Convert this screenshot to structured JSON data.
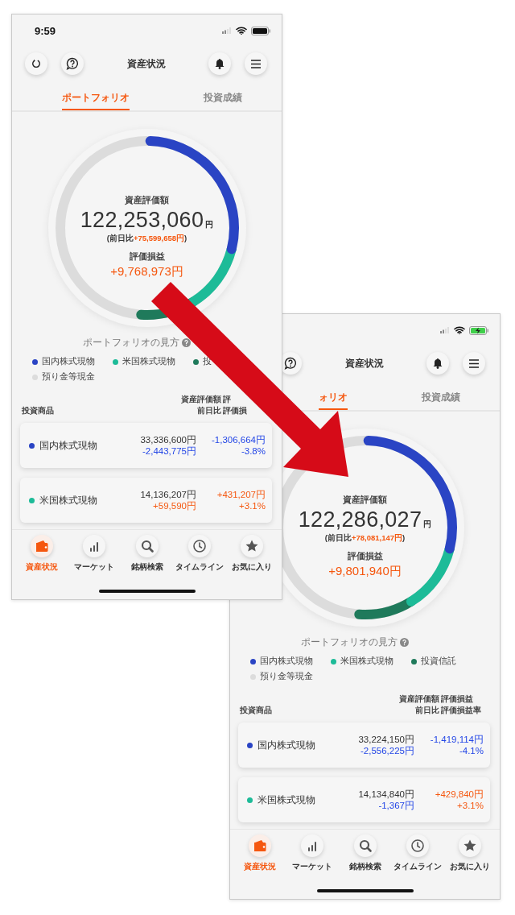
{
  "phones": [
    {
      "status_bar": {
        "time": "9:59",
        "battery_charging": false
      },
      "title": "資産状況",
      "tabs": [
        {
          "label": "ポートフォリオ",
          "selected": true
        },
        {
          "label": "投資成績",
          "selected": false
        }
      ],
      "summary": {
        "label": "資産評価額",
        "amount": "122,253,060",
        "unit": "円",
        "day_change": {
          "open": "(前日比",
          "value": "+75,599,658円",
          "close": ")",
          "gain": true
        },
        "pl_label": "評価損益",
        "pl": "+9,768,973円",
        "pl_gain": true
      },
      "legend_title": "ポートフォリオの見方",
      "legend": [
        {
          "label": "国内株式現物",
          "color": "#2a44c4"
        },
        {
          "label": "米国株式現物",
          "color": "#1dbb98"
        },
        {
          "label": "投",
          "color": "#1f7a5b"
        },
        {
          "label": "預り金等現金",
          "color": "#dcdcdc"
        }
      ],
      "table": {
        "columns": [
          [
            "投資商品"
          ],
          [
            "資産評価額",
            "前日比"
          ],
          [
            "評",
            "評価損"
          ]
        ],
        "rows": [
          {
            "name": "国内株式現物",
            "color": "#2a44c4",
            "value": "33,336,600円",
            "change": "-2,443,775円",
            "change_gain": false,
            "pl": "-1,306,664円",
            "pl_rate": "-3.8%",
            "pl_gain": false
          },
          {
            "name": "米国株式現物",
            "color": "#1dbb98",
            "value": "14,136,207円",
            "change": "+59,590円",
            "change_gain": true,
            "pl": "+431,207円",
            "pl_rate": "+3.1%",
            "pl_gain": true
          }
        ]
      },
      "nav": [
        {
          "label": "資産状況",
          "selected": true
        },
        {
          "label": "マーケット",
          "selected": false
        },
        {
          "label": "銘柄検索",
          "selected": false
        },
        {
          "label": "タイムライン",
          "selected": false
        },
        {
          "label": "お気に入り",
          "selected": false
        }
      ]
    },
    {
      "status_bar": {
        "battery_charging": true
      },
      "title": "資産状況",
      "tabs": [
        {
          "label": "ォリオ",
          "selected": true
        },
        {
          "label": "投資成績",
          "selected": false
        }
      ],
      "summary": {
        "label": "資産評価額",
        "amount": "122,286,027",
        "unit": "円",
        "day_change": {
          "open": "(前日比",
          "value": "+78,081,147円",
          "close": ")",
          "gain": true
        },
        "pl_label": "評価損益",
        "pl": "+9,801,940円",
        "pl_gain": true
      },
      "legend_title": "ポートフォリオの見方",
      "legend": [
        {
          "label": "国内株式現物",
          "color": "#2a44c4"
        },
        {
          "label": "米国株式現物",
          "color": "#1dbb98"
        },
        {
          "label": "投資信託",
          "color": "#1f7a5b"
        },
        {
          "label": "預り金等現金",
          "color": "#dcdcdc"
        }
      ],
      "table": {
        "columns": [
          [
            "投資商品"
          ],
          [
            "資産評価額",
            "前日比"
          ],
          [
            "評価損益",
            "評価損益率"
          ]
        ],
        "rows": [
          {
            "name": "国内株式現物",
            "color": "#2a44c4",
            "value": "33,224,150円",
            "change": "-2,556,225円",
            "change_gain": false,
            "pl": "-1,419,114円",
            "pl_rate": "-4.1%",
            "pl_gain": false
          },
          {
            "name": "米国株式現物",
            "color": "#1dbb98",
            "value": "14,134,840円",
            "change": "-1,367円",
            "change_gain": false,
            "pl": "+429,840円",
            "pl_rate": "+3.1%",
            "pl_gain": true
          }
        ]
      },
      "nav": [
        {
          "label": "資産状況",
          "selected": true
        },
        {
          "label": "マーケット",
          "selected": false
        },
        {
          "label": "銘柄検索",
          "selected": false
        },
        {
          "label": "タイムライン",
          "selected": false
        },
        {
          "label": "お気に入り",
          "selected": false
        }
      ]
    }
  ]
}
